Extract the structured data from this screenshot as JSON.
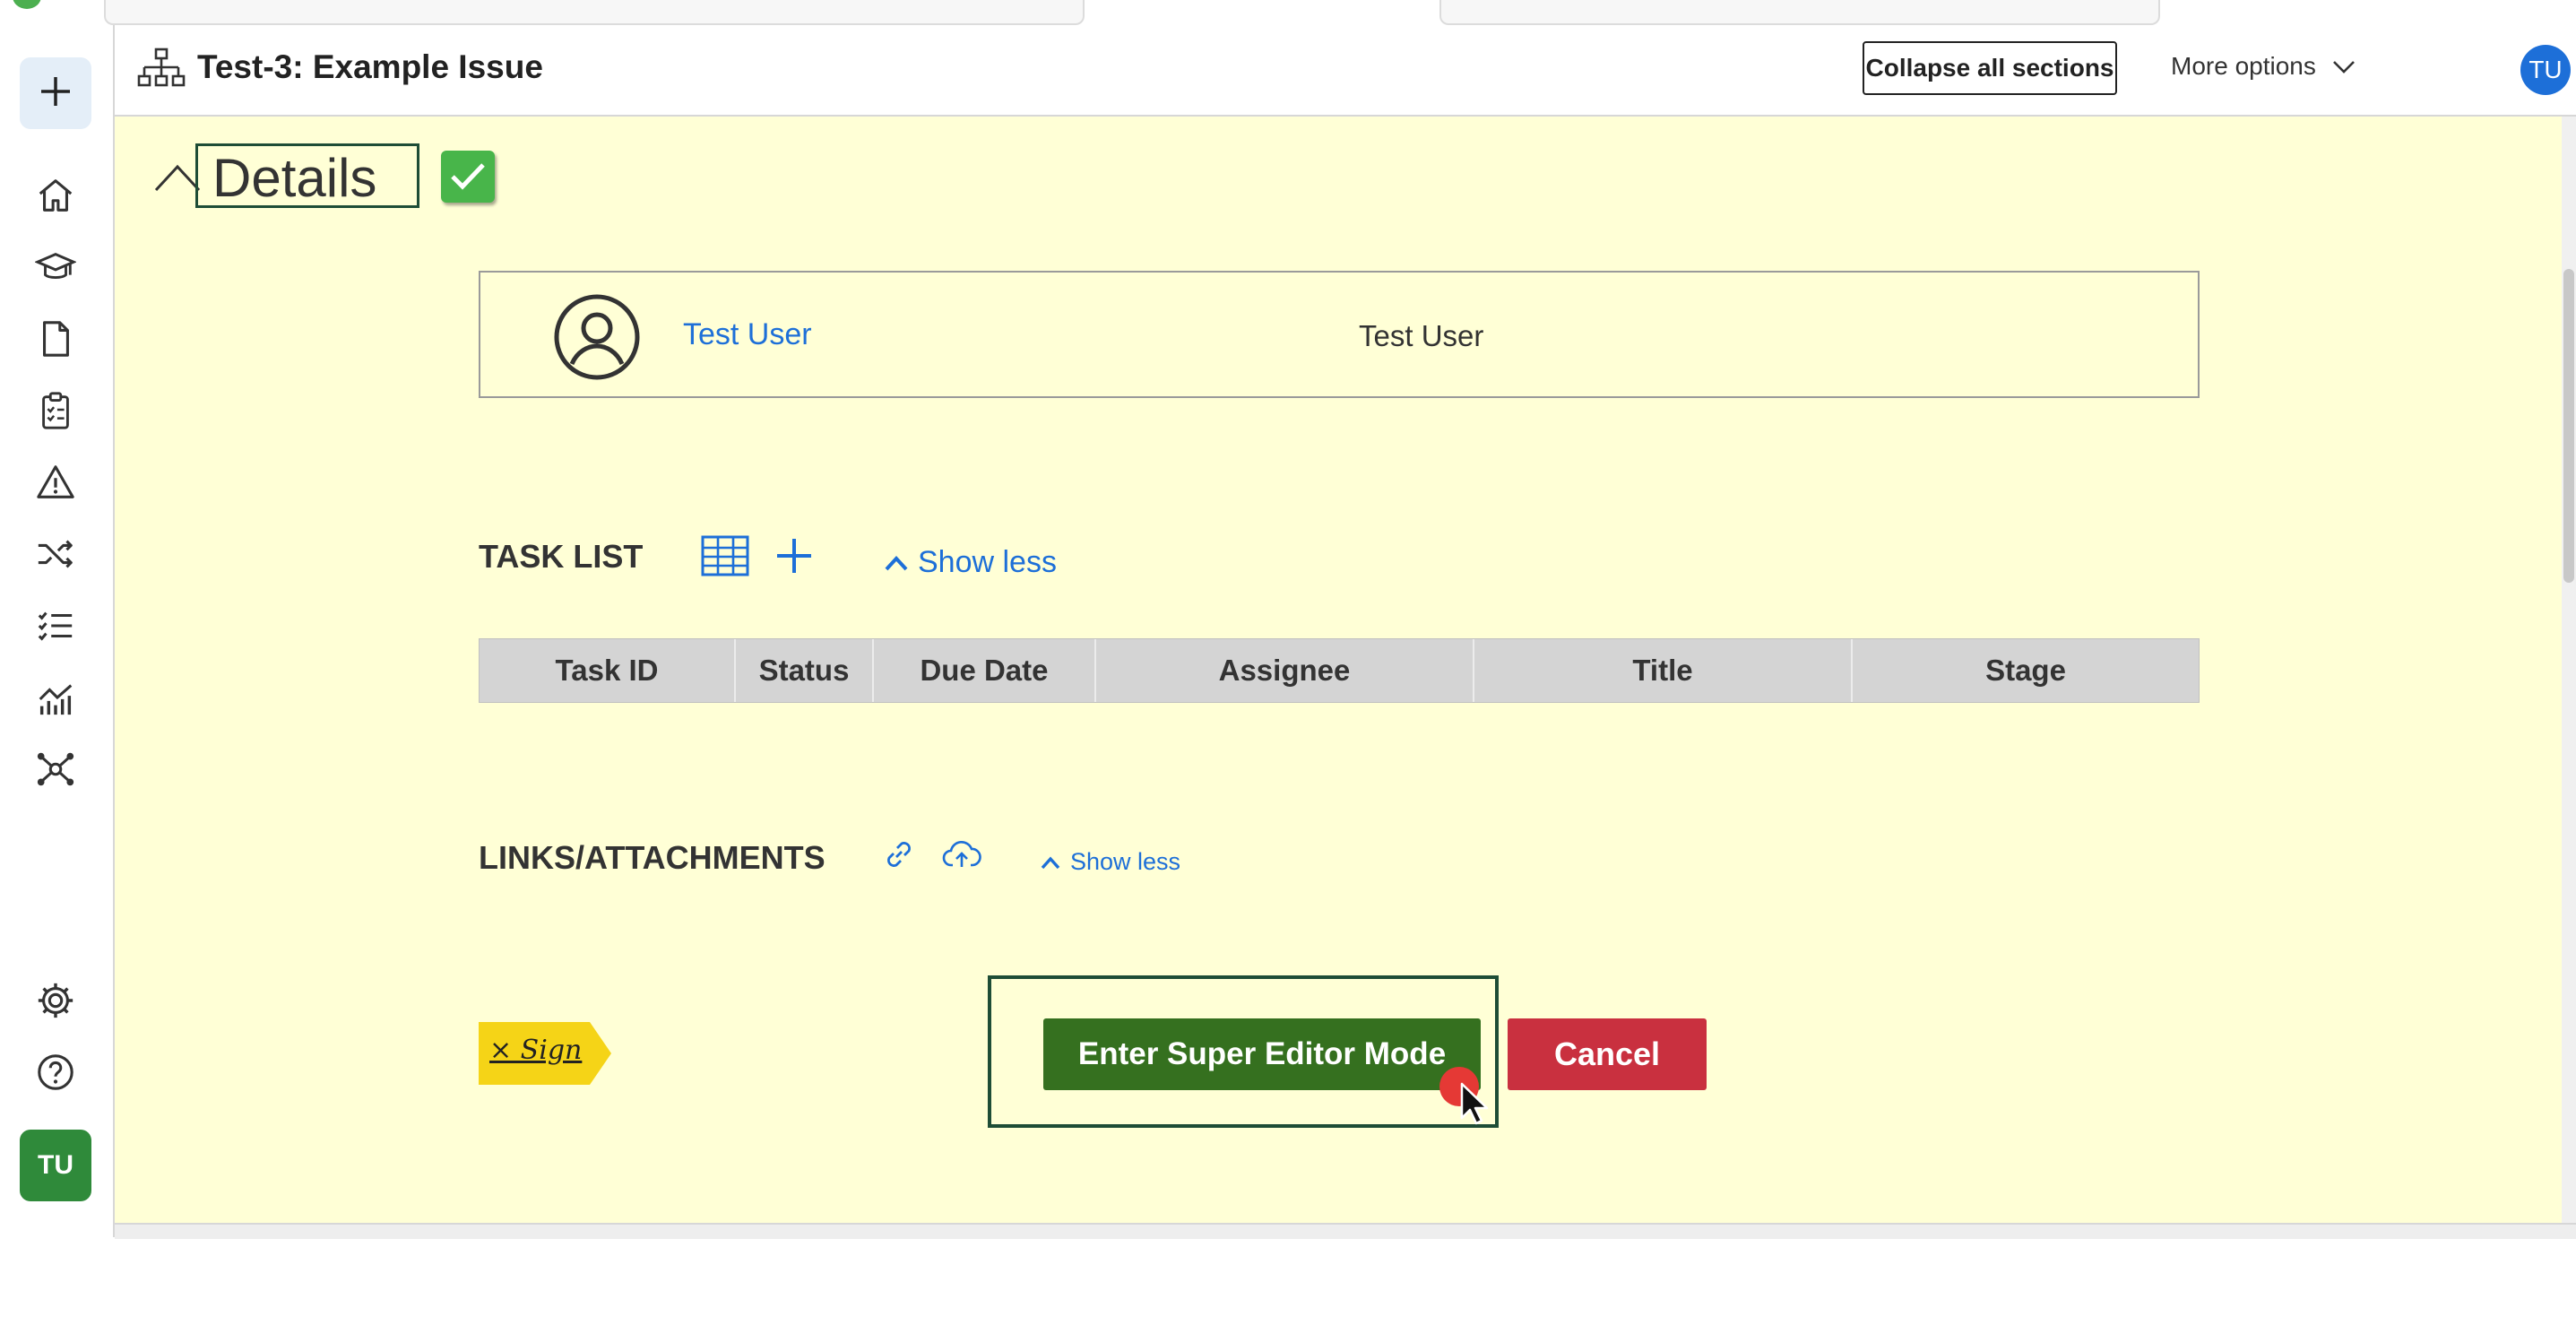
{
  "header": {
    "title": "Test-3: Example Issue",
    "collapse_label": "Collapse all sections",
    "more_options_label": "More options",
    "user_initials": "TU",
    "close_glyph": "✕"
  },
  "sidebar": {
    "add_glyph": "+",
    "items": [
      {
        "icon": "home-icon"
      },
      {
        "icon": "graduation-cap-icon"
      },
      {
        "icon": "document-icon"
      },
      {
        "icon": "clipboard-checklist-icon"
      },
      {
        "icon": "warning-icon"
      },
      {
        "icon": "shuffle-icon"
      },
      {
        "icon": "checklist-icon"
      },
      {
        "icon": "analytics-chart-icon"
      },
      {
        "icon": "network-hub-icon"
      }
    ],
    "bottom_items": [
      {
        "icon": "gear-icon"
      },
      {
        "icon": "help-icon"
      }
    ],
    "user_initials": "TU"
  },
  "details": {
    "title": "Details",
    "user_link": "Test User",
    "user_name": "Test User"
  },
  "task_list": {
    "title": "TASK LIST",
    "show_less": "Show less",
    "columns": [
      "Task ID",
      "Status",
      "Due Date",
      "Assignee",
      "Title",
      "Stage"
    ]
  },
  "links": {
    "title": "LINKS/ATTACHMENTS",
    "show_less": "Show less"
  },
  "actions": {
    "sign_label": "× Sign",
    "super_editor_label": "Enter Super Editor Mode",
    "cancel_label": "Cancel"
  },
  "colors": {
    "panel_bg": "#ffffd6",
    "link_blue": "#1d6fd8",
    "primary_green": "#35701f",
    "cancel_red": "#c9303f",
    "sign_yellow": "#f5d417"
  }
}
